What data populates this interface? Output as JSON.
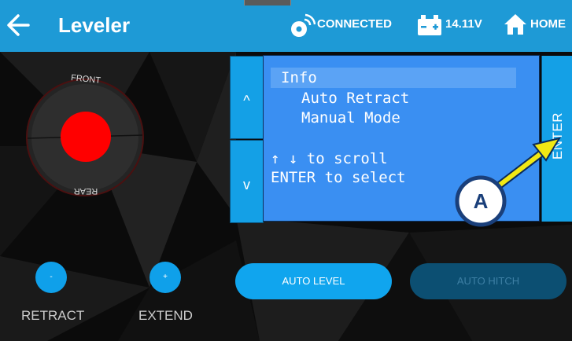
{
  "header": {
    "title": "Leveler",
    "connection_status": "CONNECTED",
    "battery_voltage": "14.11V",
    "home_label": "HOME",
    "background_color": "#1e9ad6",
    "icons": [
      "back-arrow-icon",
      "connected-wrench-icon",
      "battery-icon",
      "home-icon"
    ]
  },
  "dial": {
    "front_label": "FRONT",
    "rear_label": "REAR",
    "indicator_color": "#ff0000"
  },
  "lcd": {
    "menu_title": "Info",
    "menu_items": [
      "Auto Retract",
      "Manual Mode"
    ],
    "hint_scroll": "↑ ↓ to scroll",
    "hint_select": "ENTER to select",
    "background_color": "#3a8ff2"
  },
  "nav": {
    "up_label": "^",
    "down_label": "v",
    "enter_label": "ENTER"
  },
  "callout": {
    "label": "A",
    "color": "#f1e814"
  },
  "controls": {
    "retract_symbol": "-",
    "extend_symbol": "+",
    "retract_label": "RETRACT",
    "extend_label": "EXTEND",
    "auto_level_label": "AUTO LEVEL",
    "auto_hitch_label": "AUTO HITCH"
  }
}
